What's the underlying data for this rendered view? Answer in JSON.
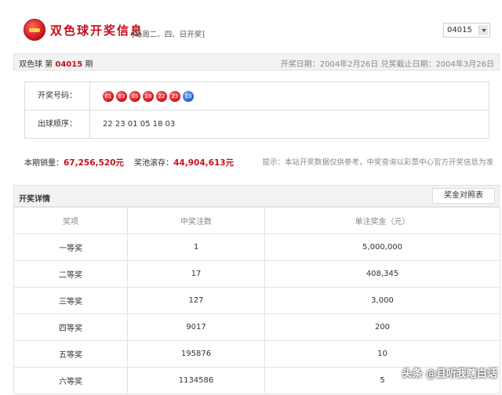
{
  "header": {
    "title": "双色球开奖信息",
    "schedule": "[每周二、四、日开奖]",
    "issue_select_value": "04015"
  },
  "info": {
    "game": "双色球 第",
    "issue": "04015",
    "issue_suffix": "期",
    "dates": "开奖日期：2004年2月26日 兑奖截止日期：2004年3月26日"
  },
  "draw": {
    "numbers_label": "开奖号码：",
    "red_balls": [
      "01",
      "03",
      "05",
      "18",
      "22",
      "23"
    ],
    "blue_ball": "13",
    "order_label": "出球顺序：",
    "order": "22 23 01 05 18 03",
    "colors": {
      "red": "#d0111b",
      "blue": "#1a5fd0"
    }
  },
  "sales": {
    "sales_label": "本期销量：",
    "sales_value": "67,256,520元",
    "pool_label": "奖池滚存：",
    "pool_value": "44,904,613元",
    "hint": "提示：本站开奖数据仅供参考，中奖查询以彩票中心官方开奖信息为准"
  },
  "details": {
    "title": "开奖详情",
    "compare_button": "奖金对照表",
    "columns": [
      "奖项",
      "中奖注数",
      "单注奖金（元）"
    ],
    "rows": [
      [
        "一等奖",
        "1",
        "5,000,000"
      ],
      [
        "二等奖",
        "17",
        "408,345"
      ],
      [
        "三等奖",
        "127",
        "3,000"
      ],
      [
        "四等奖",
        "9017",
        "200"
      ],
      [
        "五等奖",
        "195876",
        "10"
      ],
      [
        "六等奖",
        "1134586",
        "5"
      ]
    ]
  },
  "watermark": "头条 @且听我瞎白话"
}
